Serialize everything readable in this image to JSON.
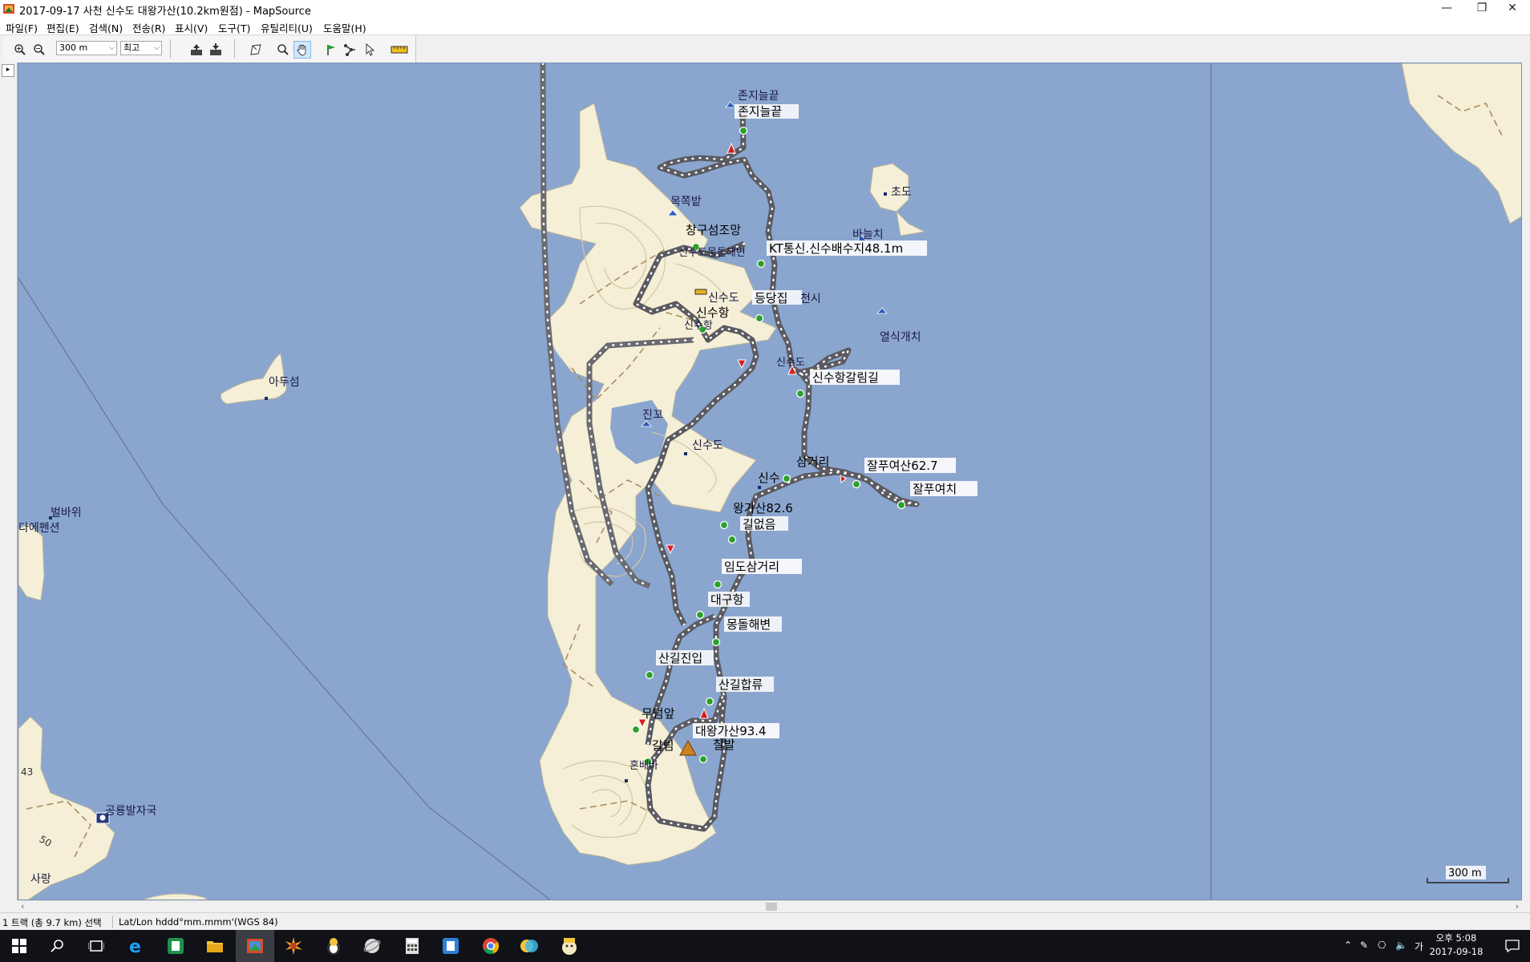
{
  "window": {
    "title": "2017-09-17 사천 신수도 대왕가산(10.2km원점) - MapSource",
    "minimize_icon": "minimize-icon",
    "restore_icon": "restore-icon",
    "close_icon": "close-icon"
  },
  "menu": [
    {
      "label": "파일(F)"
    },
    {
      "label": "편집(E)"
    },
    {
      "label": "검색(N)"
    },
    {
      "label": "전송(R)"
    },
    {
      "label": "표시(V)"
    },
    {
      "label": "도구(T)"
    },
    {
      "label": "유틸리티(U)"
    },
    {
      "label": "도움말(H)"
    }
  ],
  "toolbar": {
    "zoom_value": "300 m",
    "detail_value": "최고",
    "icons": [
      "zoom-in-icon",
      "zoom-out-icon",
      "receive-from-device-icon",
      "send-to-device-icon",
      "map-select-icon",
      "zoom-tool-icon",
      "hand-pan-icon",
      "waypoint-flag-icon",
      "route-icon",
      "selection-pointer-icon",
      "distance-ruler-icon"
    ]
  },
  "map": {
    "colors": {
      "water": "#8aa6cf",
      "land": "#f4efd6",
      "contour": "#d4c7a4",
      "track": "#5a5a60"
    },
    "labels": {
      "jonji1": "존지늘끝",
      "jonji2": "존지늘끝",
      "mokjjok": "목쪽밭",
      "changgu": "창구섬조망",
      "kt": "KT통신.신수배수지48.1m",
      "chodo": "초도",
      "badal": "바늘치",
      "beach_top": "신수도몽돌해변",
      "sinsu_do1": "신수도",
      "dungdang": "등당집",
      "cheonsi": "천시",
      "port": "신수항",
      "port2": "신수항",
      "yeolsik": "열식개치",
      "sinsu_small": "신수도",
      "galrimgil": "신수항갈림길",
      "adu": "아두섬",
      "jin": "진꼬",
      "sinsudo_center": "신수도",
      "samgeori": "삼거리",
      "sinsu": "신수",
      "jalpu_peak": "잘푸여산62.7",
      "jalpu": "잘푸여치",
      "wanggasan": "왕가산82.6",
      "gilup": "길없음",
      "imdo": "임도삼거리",
      "daegu": "대구항",
      "mongdol": "몽돌해변",
      "sangiljin": "산길진입",
      "sangilhap": "산길합류",
      "mudeom": "무덤앞",
      "daewang": "대왕가산93.4",
      "chilbal": "칠발",
      "galrim": "갈림",
      "homebay": "혼배바",
      "beolbawi": "벌바위",
      "dae_pension": "다에펜션",
      "gonggong": "공룡발자국",
      "num43": "43",
      "num50": "50",
      "sarang": "사랑"
    },
    "scale_label": "300 m"
  },
  "status": {
    "selection": "1 트랙 (총 9.7 km) 선택",
    "coord_format": "Lat/Lon hddd°mm.mmm'(WGS 84)"
  },
  "taskbar": {
    "icons": [
      "windows-start-icon",
      "search-icon",
      "task-view-icon",
      "internet-explorer-icon",
      "app-green-icon",
      "file-explorer-icon",
      "mapsource-icon",
      "paint-splash-icon",
      "penguin-app-icon",
      "globe-app-icon",
      "calculator-icon",
      "notepad-app-icon",
      "chrome-icon",
      "chat-app-icon",
      "kakao-app-icon"
    ],
    "tray_ime": "가",
    "clock_time": "오후 5:08",
    "clock_date": "2017-09-18"
  }
}
